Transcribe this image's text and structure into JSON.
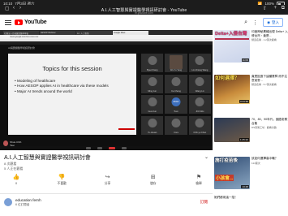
{
  "status_bar": {
    "time": "10:10",
    "date": "7月3日 週六",
    "battery": "100%"
  },
  "window": {
    "title": "A.I.人工智慧與實證醫學視訊研討會 - YouTube",
    "subtitle": "m.youtube.com"
  },
  "header": {
    "logo": "YouTube",
    "search_icon": "⌕",
    "more_icon": "⋮",
    "login_label": "登入"
  },
  "player": {
    "tabs": [
      "社團法人台灣實證醫學學會",
      "AESOP Webinar",
      "A.I. 人工智慧",
      "Google Meet"
    ],
    "address": "meet.google.com/xxx-xxxx-xxx",
    "meeting_title": "AI與實證醫學視訊研討會",
    "slide": {
      "title": "Topics for this session",
      "bullets": [
        "Modeling of healthcare",
        "How AESOP applies AI in healthcare via these models",
        "Major AI trends around the world"
      ]
    },
    "participants": [
      "Byeol Kang",
      "Wu-Yu Yang",
      "Lin-Chiang Wang",
      "Ming Jun",
      "Ke Cheng",
      "Wang Lin",
      "Guo-Kun",
      "Tsun",
      "Jhih Wei",
      "Yu-Hsuan",
      "Cora",
      "Chih-yu Chen"
    ],
    "text_tile": "IPAD",
    "speaker": "Shun-Chih Tsai"
  },
  "video": {
    "title": "A.I.人工智慧與實證醫學視訊研討會",
    "meta1": "8 次觀看",
    "meta2": "5 人正在觀看",
    "actions": [
      {
        "icon": "👍",
        "label": "0"
      },
      {
        "icon": "👎",
        "label": "不喜歡"
      },
      {
        "icon": "↪",
        "label": "分享"
      },
      {
        "icon": "⊞",
        "label": "儲存"
      },
      {
        "icon": "⚑",
        "label": "檢舉"
      }
    ]
  },
  "channel": {
    "name": "education fernh",
    "subs": "6 位訂閱者",
    "subscribe_label": "訂閱"
  },
  "sidebar": [
    {
      "thumb_text": "Delta+入侵台灣",
      "title": "印度神秘異種出現 Delta+ 入侵台灣・竟是...",
      "meta": "頻道名稱 · 1.2萬次觀看",
      "duration": "11:03"
    },
    {
      "thumb_text": "如何選擇？",
      "title": "竟是因造下這種業障 而不注意就會...",
      "meta": "頻道名稱 · 5.7萬次觀看",
      "duration": "3:44:39"
    },
    {
      "thumb_text": "",
      "title": "70、80、90年代，國語老歌合集",
      "meta": "DS音樂工坊 · 觀看次數",
      "duration": "1:25:22"
    },
    {
      "thumb_text": "施打疫苗後",
      "title": "該如何選擇高中職？",
      "meta": "114萬次",
      "duration": "13:48"
    },
    {
      "thumb_text": "",
      "title": "她們都用這一招！",
      "meta": "",
      "duration": ""
    }
  ]
}
